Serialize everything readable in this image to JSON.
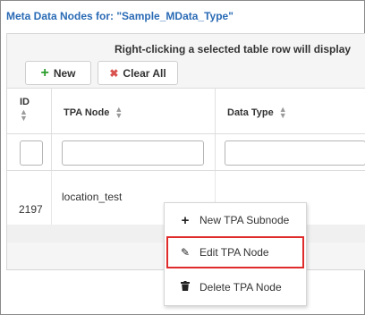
{
  "header": {
    "title": "Meta Data Nodes for: \"Sample_MData_Type\""
  },
  "toolbar": {
    "message": "Right-clicking a selected table row will display",
    "new_label": "New",
    "clear_label": "Clear All"
  },
  "table": {
    "columns": {
      "id": "ID",
      "tpa_node": "TPA Node",
      "data_type": "Data Type"
    },
    "rows": [
      {
        "id": "2197",
        "tpa_node": "location_test",
        "data_type": ""
      }
    ]
  },
  "context_menu": {
    "items": [
      {
        "label": "New TPA Subnode",
        "icon": "plus-icon"
      },
      {
        "label": "Edit TPA Node",
        "icon": "pencil-icon"
      },
      {
        "label": "Delete TPA Node",
        "icon": "trash-icon"
      }
    ],
    "highlighted": "Edit TPA Node",
    "highlight_color": "#e02b2b"
  },
  "colors": {
    "title_blue": "#2a6bb5",
    "new_green": "#2a9d2a",
    "clear_red": "#d9534f"
  }
}
